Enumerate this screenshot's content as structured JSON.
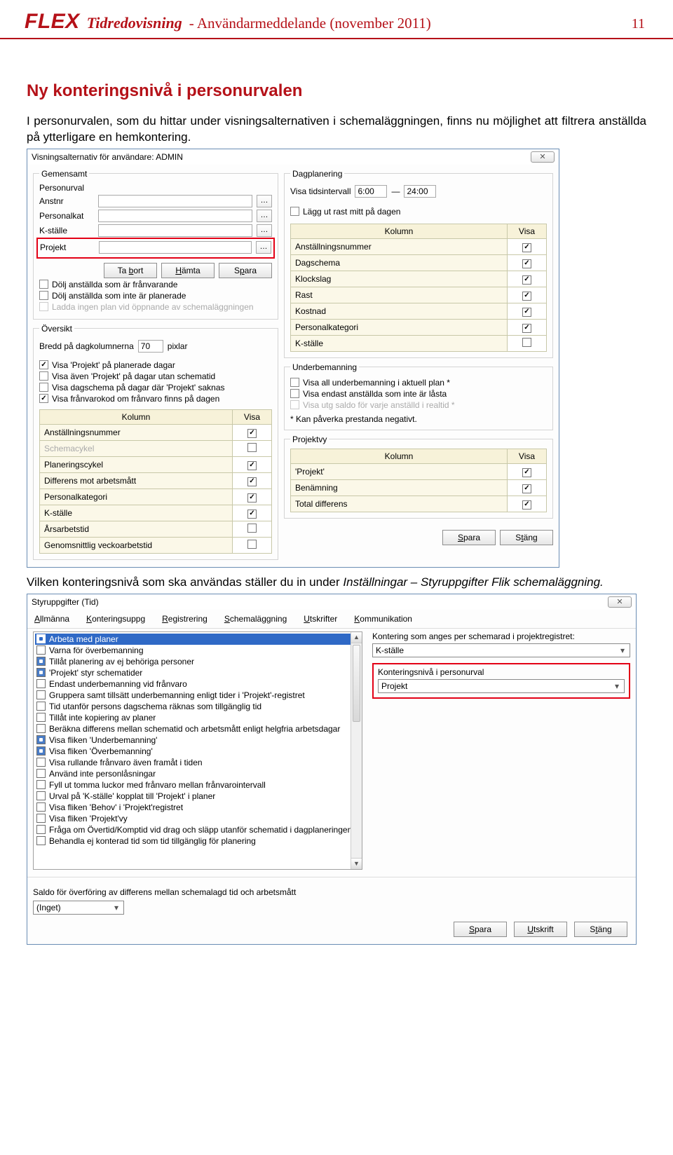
{
  "header": {
    "logo": "FLEX",
    "title": "Tidredovisning",
    "subtitle": " - Användarmeddelande (november 2011)",
    "page_number": "11"
  },
  "heading": "Ny konteringsnivå i personurvalen",
  "intro": "I personurvalen, som du hittar under visningsalternativen i schemaläggningen, finns nu möjlighet att filtrera anställda på ytterligare en hemkontering.",
  "dialog1": {
    "title": "Visningsalternativ för användare: ADMIN",
    "gemensamt_legend": "Gemensamt",
    "personurval_legend": "Personurval",
    "rows": {
      "anstnr": "Anstnr",
      "personalkat": "Personalkat",
      "kstalle": "K-ställe",
      "projekt": "Projekt"
    },
    "buttons": {
      "tabort": "Ta bort",
      "hamta": "Hämta",
      "spara": "Spara"
    },
    "chk1": "Dölj anställda som är frånvarande",
    "chk2": "Dölj anställda som inte är planerade",
    "chk3": "Ladda ingen plan vid öppnande av schemaläggningen",
    "oversikt_legend": "Översikt",
    "bredd_label": "Bredd på dagkolumnerna",
    "bredd_val": "70",
    "bredd_unit": "pixlar",
    "ovchk1": "Visa 'Projekt' på planerade dagar",
    "ovchk2": "Visa även 'Projekt' på dagar utan schematid",
    "ovchk3": "Visa dagschema på dagar där 'Projekt' saknas",
    "ovchk4": "Visa frånvarokod om frånvaro finns på dagen",
    "col_kolumn": "Kolumn",
    "col_visa": "Visa",
    "ov_table": [
      {
        "k": "Anställningsnummer",
        "v": true
      },
      {
        "k": "Schemacykel",
        "v": false,
        "grey": true
      },
      {
        "k": "Planeringscykel",
        "v": true
      },
      {
        "k": "Differens mot arbetsmått",
        "v": true
      },
      {
        "k": "Personalkategori",
        "v": true
      },
      {
        "k": "K-ställe",
        "v": true
      },
      {
        "k": "Årsarbetstid",
        "v": false
      },
      {
        "k": "Genomsnittlig veckoarbetstid",
        "v": false
      }
    ],
    "dagplan_legend": "Dagplanering",
    "visa_tids_lbl": "Visa tidsintervall",
    "tids_from": "6:00",
    "tids_to": "24:00",
    "dagchk": "Lägg ut rast mitt på dagen",
    "dag_table": [
      {
        "k": "Anställningsnummer",
        "v": true
      },
      {
        "k": "Dagschema",
        "v": true
      },
      {
        "k": "Klockslag",
        "v": true
      },
      {
        "k": "Rast",
        "v": true
      },
      {
        "k": "Kostnad",
        "v": true
      },
      {
        "k": "Personalkategori",
        "v": true
      },
      {
        "k": "K-ställe",
        "v": false
      }
    ],
    "under_legend": "Underbemanning",
    "uchk1": "Visa all underbemanning i aktuell plan *",
    "uchk2": "Visa endast anställda som inte är låsta",
    "uchk3": "Visa utg saldo för varje anställd i realtid *",
    "unote": "* Kan påverka prestanda negativt.",
    "proj_legend": "Projektvy",
    "proj_table": [
      {
        "k": "'Projekt'",
        "v": true
      },
      {
        "k": "Benämning",
        "v": true
      },
      {
        "k": "Total differens",
        "v": true
      }
    ],
    "foot_spara": "Spara",
    "foot_stang": "Stäng"
  },
  "mid_text": "Vilken konteringsnivå som ska användas ställer du in under",
  "mid_italic1": "Inställningar – Styruppgifter",
  "mid_sep": " ",
  "mid_italic2": "Flik schemaläggning.",
  "dialog2": {
    "title": "Styruppgifter (Tid)",
    "tabs": [
      "Allmänna",
      "Konteringsuppg",
      "Registrering",
      "Schemaläggning",
      "Utskrifter",
      "Kommunikation"
    ],
    "list": [
      {
        "t": "Arbeta med planer",
        "c": true,
        "sel": true
      },
      {
        "t": "Varna för överbemanning",
        "c": false
      },
      {
        "t": "Tillåt planering av ej behöriga personer",
        "c": true
      },
      {
        "t": "'Projekt' styr schematider",
        "c": true
      },
      {
        "t": "Endast underbemanning vid frånvaro",
        "c": false
      },
      {
        "t": "Gruppera samt tillsätt underbemanning enligt tider i 'Projekt'-registret",
        "c": false
      },
      {
        "t": "Tid utanför persons dagschema räknas som tillgänglig tid",
        "c": false
      },
      {
        "t": "Tillåt inte kopiering av planer",
        "c": false
      },
      {
        "t": "Beräkna differens mellan schematid och arbetsmått enligt helgfria arbetsdagar",
        "c": false
      },
      {
        "t": "Visa fliken 'Underbemanning'",
        "c": true
      },
      {
        "t": "Visa fliken 'Överbemanning'",
        "c": true
      },
      {
        "t": "Visa rullande frånvaro även framåt i tiden",
        "c": false
      },
      {
        "t": "Använd inte personlåsningar",
        "c": false
      },
      {
        "t": "Fyll ut tomma luckor med frånvaro mellan frånvarointervall",
        "c": false
      },
      {
        "t": "Urval på 'K-ställe' kopplat till 'Projekt' i planer",
        "c": false
      },
      {
        "t": "Visa fliken 'Behov' i 'Projekt'registret",
        "c": false
      },
      {
        "t": "Visa fliken 'Projekt'vy",
        "c": false
      },
      {
        "t": "Fråga om Övertid/Komptid vid drag och släpp utanför schematid i dagplaneringen",
        "c": false
      },
      {
        "t": "Behandla ej konterad tid som tid tillgänglig för planering",
        "c": false
      }
    ],
    "r_label": "Kontering som anges per schemarad i projektregistret:",
    "r_value": "K-ställe",
    "r2_label": "Konteringsnivå i personurval",
    "r2_value": "Projekt",
    "saldo_label": "Saldo för överföring av differens mellan schemalagd tid och arbetsmått",
    "saldo_value": "(Inget)",
    "btns": {
      "spara": "Spara",
      "utskrift": "Utskrift",
      "stang": "Stäng"
    }
  }
}
